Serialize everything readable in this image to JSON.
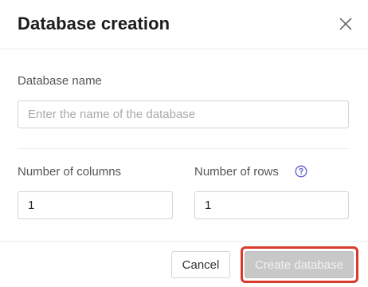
{
  "dialog": {
    "title": "Database creation",
    "close_icon": "close-icon"
  },
  "form": {
    "name_label": "Database name",
    "name_placeholder": "Enter the name of the database",
    "name_value": "",
    "columns_label": "Number of columns",
    "columns_value": "1",
    "rows_label": "Number of rows",
    "rows_value": "1",
    "help_icon": "question-circle-icon"
  },
  "footer": {
    "cancel_label": "Cancel",
    "create_label": "Create database",
    "create_disabled": true
  },
  "colors": {
    "help_accent": "#5b5bd6",
    "highlight_border": "#d93a2b",
    "disabled_button_bg": "#c8c8c8"
  }
}
